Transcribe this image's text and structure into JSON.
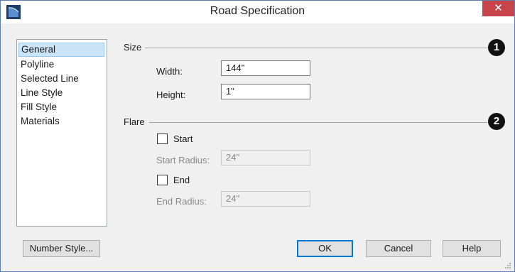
{
  "window": {
    "title": "Road Specification",
    "close_glyph": "✕",
    "accent": "#c7454a"
  },
  "nav": {
    "items": [
      {
        "label": "General",
        "selected": true
      },
      {
        "label": "Polyline"
      },
      {
        "label": "Selected Line"
      },
      {
        "label": "Line Style"
      },
      {
        "label": "Fill Style"
      },
      {
        "label": "Materials"
      }
    ]
  },
  "size": {
    "group_label": "Size",
    "badge": "1",
    "width_label": "Width:",
    "width_value": "144\"",
    "height_label": "Height:",
    "height_value": "1\""
  },
  "flare": {
    "group_label": "Flare",
    "badge": "2",
    "start_label": "Start",
    "start_checked": false,
    "start_radius_label": "Start Radius:",
    "start_radius_value": "24\"",
    "end_label": "End",
    "end_checked": false,
    "end_radius_label": "End Radius:",
    "end_radius_value": "24\""
  },
  "buttons": {
    "number_style": "Number Style...",
    "ok": "OK",
    "cancel": "Cancel",
    "help": "Help"
  }
}
